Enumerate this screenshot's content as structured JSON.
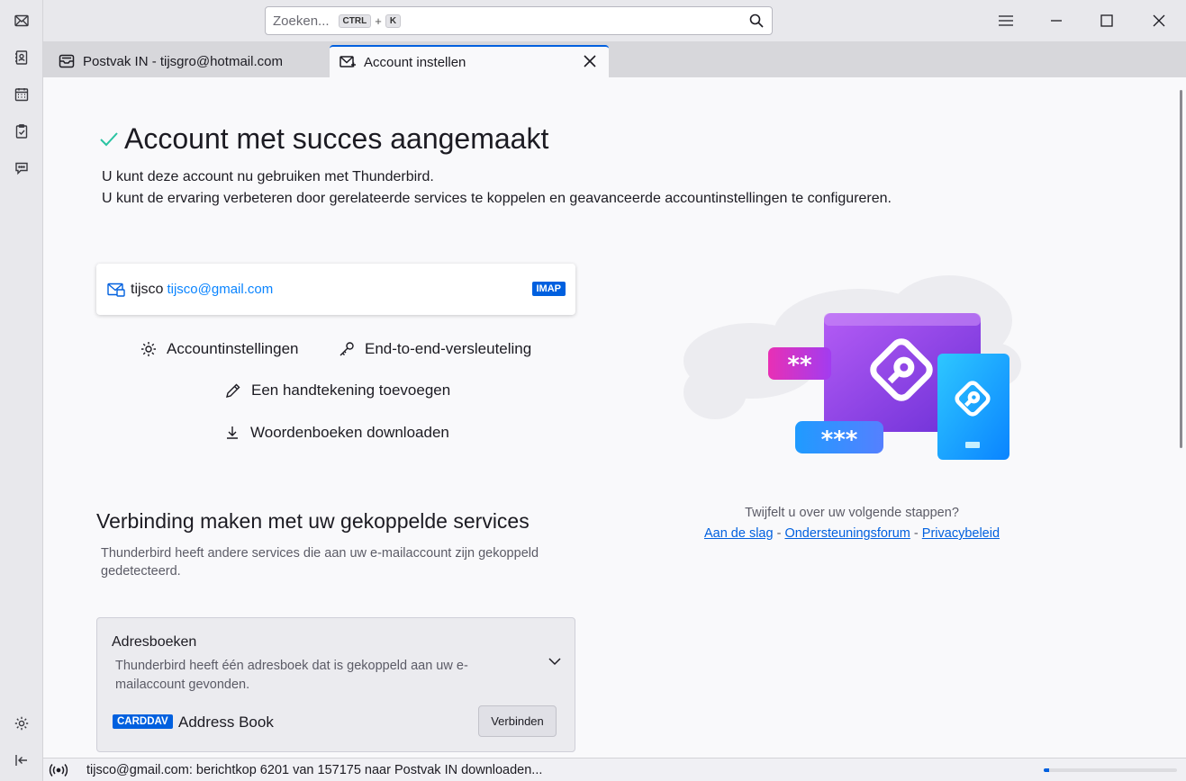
{
  "search": {
    "placeholder": "Zoeken...",
    "shortcut_key1": "CTRL",
    "shortcut_plus": "+",
    "shortcut_key2": "K"
  },
  "tabs": [
    {
      "label": "Postvak IN - tijsgro@hotmail.com"
    },
    {
      "label": "Account instellen"
    }
  ],
  "main": {
    "heading": "Account met succes aangemaakt",
    "subtitle_line1": "U kunt deze account nu gebruiken met Thunderbird.",
    "subtitle_line2": "U kunt de ervaring verbeteren door gerelateerde services te koppelen en geavanceerde accountinstellingen te configureren."
  },
  "account": {
    "name": "tijsco",
    "email": "tijsco@gmail.com",
    "protocol": "IMAP"
  },
  "actions": {
    "account_settings": "Accountinstellingen",
    "e2e": "End-to-end-versleuteling",
    "signature": "Een handtekening toevoegen",
    "dictionaries": "Woordenboeken downloaden"
  },
  "services": {
    "title": "Verbinding maken met uw gekoppelde services",
    "description": "Thunderbird heeft andere services die aan uw e-mailaccount zijn gekoppeld gedetecteerd."
  },
  "addressbooks": {
    "title": "Adresboeken",
    "description": "Thunderbird heeft één adresboek dat is gekoppeld aan uw e-mailaccount gevonden.",
    "badge": "CARDDAV",
    "name": "Address Book",
    "connect_label": "Verbinden"
  },
  "help": {
    "question": "Twijfelt u over uw volgende stappen?",
    "link1": "Aan de slag",
    "sep1": " - ",
    "link2": "Ondersteuningsforum",
    "sep2": " - ",
    "link3": "Privacybeleid"
  },
  "illustration": {
    "password_mask_1": "**",
    "password_mask_2": "***"
  },
  "status": {
    "text": "tijsco@gmail.com: berichtkop 6201 van 157175 naar Postvak IN downloaden...",
    "progress_fraction": 0.04
  },
  "colors": {
    "accent": "#0060df",
    "link": "#0a84ff",
    "success": "#2ac3a2"
  }
}
